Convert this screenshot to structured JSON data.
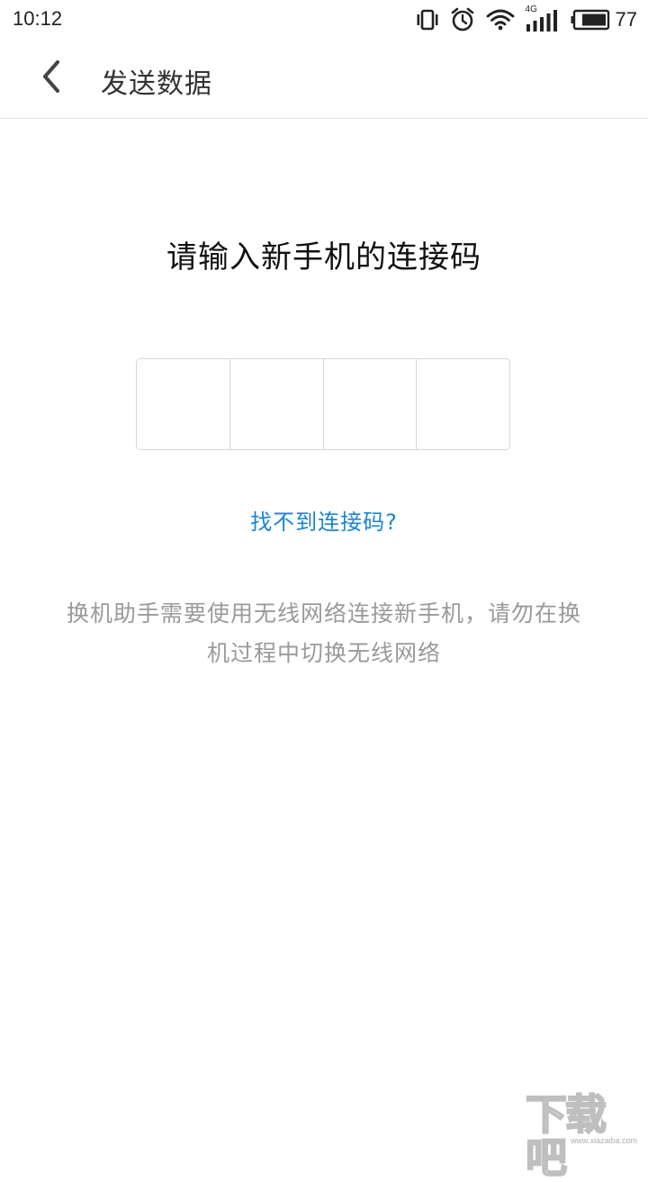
{
  "status_bar": {
    "time": "10:12",
    "network_label": "4G",
    "battery": "77",
    "icons": [
      "vibrate-icon",
      "alarm-icon",
      "wifi-icon",
      "signal-icon",
      "battery-icon"
    ]
  },
  "app_bar": {
    "title": "发送数据",
    "back_icon": "chevron-left-icon"
  },
  "main": {
    "prompt": "请输入新手机的连接码",
    "code_cells": [
      "",
      "",
      "",
      ""
    ],
    "help_link": "找不到连接码?",
    "notice": "换机助手需要使用无线网络连接新手机，请勿在换机过程中切换无线网络"
  },
  "watermark": {
    "text": "下载吧",
    "url": "www.xiazaiba.com"
  },
  "colors": {
    "link": "#1a85d4",
    "notice": "#9a9a9a",
    "divider": "#e3e3e3"
  }
}
